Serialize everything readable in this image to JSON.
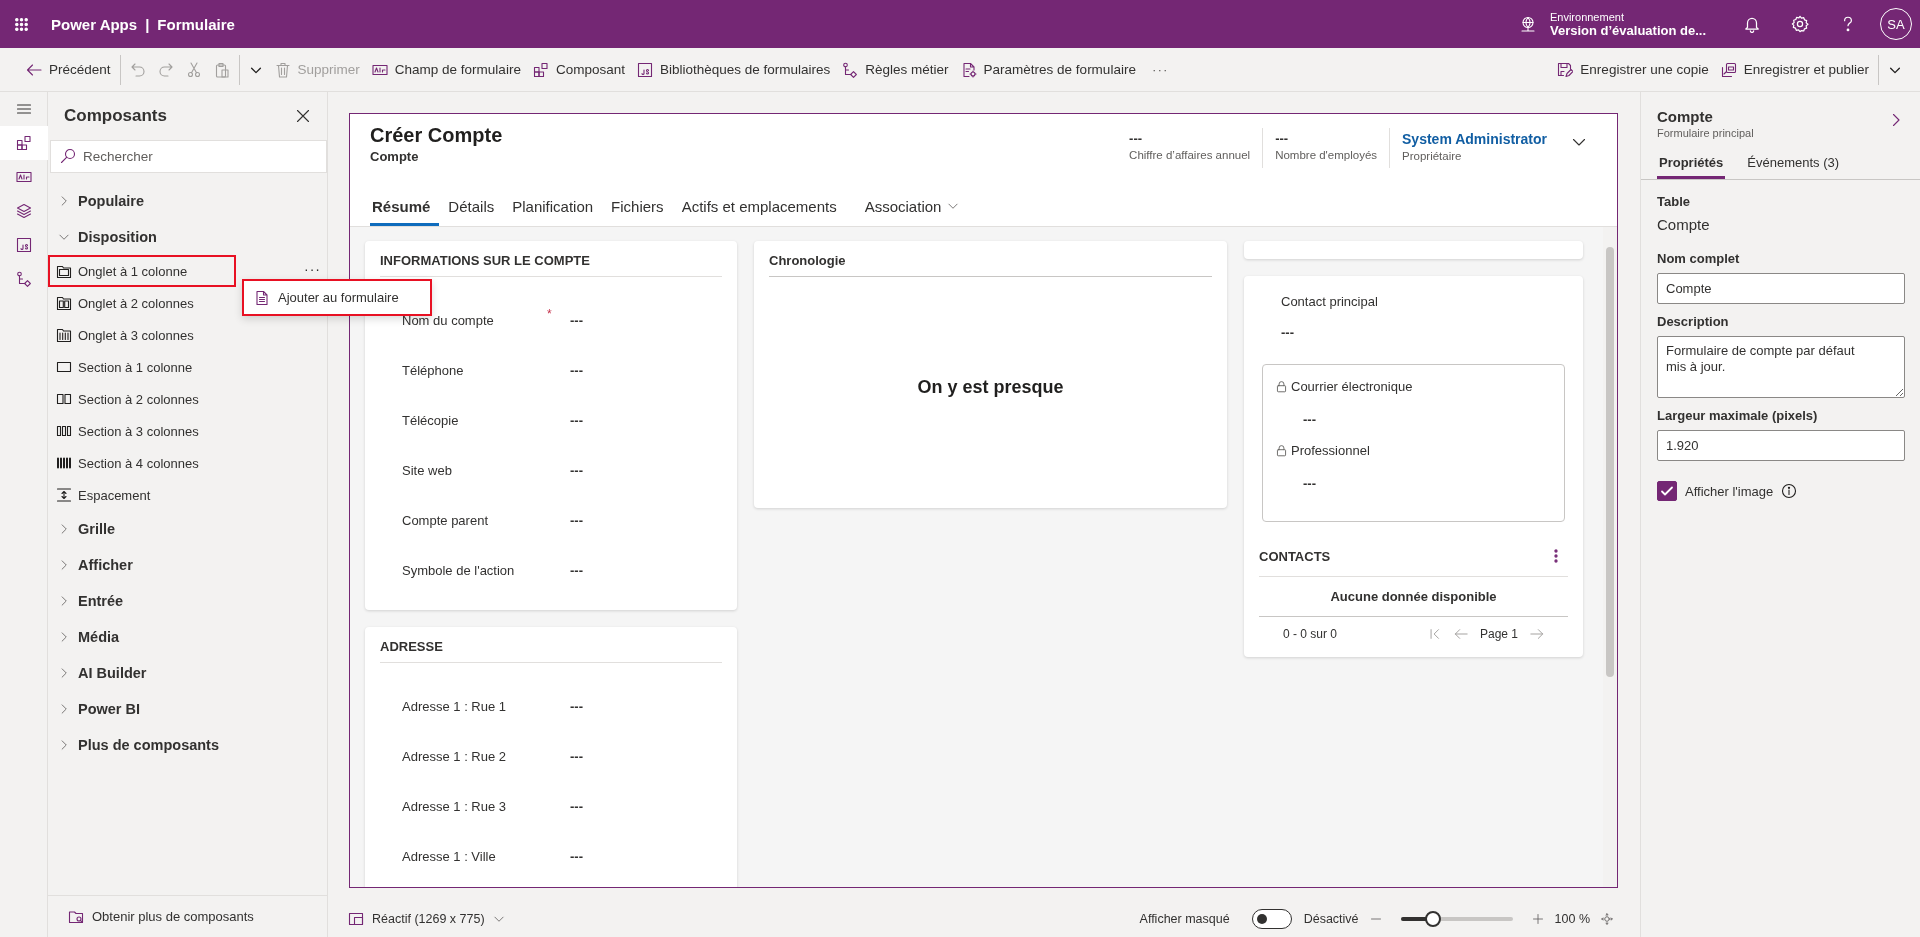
{
  "app_bar": {
    "product": "Power Apps",
    "separator": "|",
    "page": "Formulaire",
    "environment_label": "Environnement",
    "environment": "Version d’évaluation de...",
    "avatar": "SA"
  },
  "toolbar": {
    "left": [
      {
        "kind": "back",
        "label": "Précédent",
        "disabled": false
      },
      {
        "kind": "divider"
      },
      {
        "kind": "undo",
        "disabled": true
      },
      {
        "kind": "redo",
        "disabled": true
      },
      {
        "kind": "cut",
        "disabled": true
      },
      {
        "kind": "paste",
        "disabled": true
      },
      {
        "kind": "divider"
      },
      {
        "kind": "caret"
      },
      {
        "kind": "delete",
        "label": "Supprimer",
        "disabled": true
      },
      {
        "kind": "field",
        "label": "Champ de formulaire",
        "disabled": false
      },
      {
        "kind": "component",
        "label": "Composant",
        "disabled": false
      },
      {
        "kind": "library",
        "label": "Bibliothèques de formulaires",
        "disabled": false
      },
      {
        "kind": "rules",
        "label": "Règles métier",
        "disabled": false
      },
      {
        "kind": "settings",
        "label": "Paramètres de formulaire",
        "disabled": false
      },
      {
        "kind": "more",
        "label": "···",
        "disabled": false
      }
    ],
    "right": [
      {
        "kind": "save-copy",
        "label": "Enregistrer une copie",
        "disabled": false
      },
      {
        "kind": "publish",
        "label": "Enregistrer et publier",
        "disabled": false
      },
      {
        "kind": "divider"
      },
      {
        "kind": "caret"
      }
    ]
  },
  "rail": [
    {
      "kind": "menu",
      "selected": false
    },
    {
      "kind": "components",
      "selected": true
    },
    {
      "kind": "field",
      "selected": false
    },
    {
      "kind": "layers",
      "selected": false
    },
    {
      "kind": "library",
      "selected": false
    },
    {
      "kind": "rules",
      "selected": false
    }
  ],
  "components_panel": {
    "title": "Composants",
    "search": {
      "placeholder": "Rechercher"
    },
    "groups": [
      {
        "label": "Populaire",
        "expanded": false
      },
      {
        "label": "Disposition",
        "expanded": true,
        "children": [
          {
            "kind": "tab1",
            "label": "Onglet à 1 colonne",
            "highlighted": true,
            "more": "···"
          },
          {
            "kind": "tab2",
            "label": "Onglet à 2 colonnes",
            "highlighted": false
          },
          {
            "kind": "tab3",
            "label": "Onglet à 3 colonnes",
            "highlighted": false
          },
          {
            "kind": "sec1",
            "label": "Section à 1 colonne",
            "highlighted": false
          },
          {
            "kind": "sec2",
            "label": "Section à 2 colonnes",
            "highlighted": false
          },
          {
            "kind": "sec3",
            "label": "Section à 3 colonnes",
            "highlighted": false
          },
          {
            "kind": "sec4",
            "label": "Section à 4 colonnes",
            "highlighted": false
          },
          {
            "kind": "spacer",
            "label": "Espacement",
            "highlighted": false
          }
        ]
      },
      {
        "label": "Grille",
        "expanded": false
      },
      {
        "label": "Afficher",
        "expanded": false
      },
      {
        "label": "Entrée",
        "expanded": false
      },
      {
        "label": "Média",
        "expanded": false
      },
      {
        "label": "AI Builder",
        "expanded": false
      },
      {
        "label": "Power BI",
        "expanded": false
      },
      {
        "label": "Plus de composants",
        "expanded": false
      }
    ],
    "footer": "Obtenir plus de composants"
  },
  "context_menu": {
    "items": [
      {
        "label": "Ajouter au formulaire",
        "highlighted": true
      }
    ]
  },
  "form": {
    "title": "Créer Compte",
    "subtitle": "Compte",
    "required_symbol": "*",
    "header_fields": [
      {
        "kind": "text",
        "value": "---",
        "label": "Chiffre d’affaires annuel"
      },
      {
        "kind": "text",
        "value": "---",
        "label": "Nombre d'employés"
      },
      {
        "kind": "link",
        "value": "System Administrator",
        "label": "Propriétaire"
      }
    ],
    "tabs": [
      {
        "label": "Résumé",
        "selected": true,
        "has_menu": false
      },
      {
        "label": "Détails",
        "selected": false,
        "has_menu": false
      },
      {
        "label": "Planification",
        "selected": false,
        "has_menu": false
      },
      {
        "label": "Fichiers",
        "selected": false,
        "has_menu": false
      },
      {
        "label": "Actifs et emplacements",
        "selected": false,
        "has_menu": false
      },
      {
        "label": "Association",
        "selected": false,
        "has_menu": true
      }
    ],
    "column_1": [
      {
        "title": "INFORMATIONS SUR LE COMPTE",
        "fields": [
          {
            "label": "Nom du compte",
            "value": "---",
            "required": true
          },
          {
            "label": "Téléphone",
            "value": "---",
            "required": false
          },
          {
            "label": "Télécopie",
            "value": "---",
            "required": false
          },
          {
            "label": "Site web",
            "value": "---",
            "required": false
          },
          {
            "label": "Compte parent",
            "value": "---",
            "required": false
          },
          {
            "label": "Symbole de l'action",
            "value": "---",
            "required": false
          }
        ]
      },
      {
        "title": "ADRESSE",
        "fields": [
          {
            "label": "Adresse 1 : Rue 1",
            "value": "---",
            "required": false
          },
          {
            "label": "Adresse 1 : Rue 2",
            "value": "---",
            "required": false
          },
          {
            "label": "Adresse 1 : Rue 3",
            "value": "---",
            "required": false
          },
          {
            "label": "Adresse 1 : Ville",
            "value": "---",
            "required": false
          }
        ]
      }
    ],
    "column_2": {
      "title": "Chronologie",
      "message": "On y est presque"
    },
    "column_3": {
      "contact_label": "Contact principal",
      "contact_value": "---",
      "locked_fields": [
        {
          "label": "Courrier électronique",
          "value": "---"
        },
        {
          "label": "Professionnel",
          "value": "---"
        }
      ],
      "grid": {
        "title": "CONTACTS",
        "empty": "Aucune donnée disponible",
        "range": "0 - 0 sur 0",
        "page": "Page 1"
      }
    }
  },
  "properties": {
    "title": "Compte",
    "subtitle": "Formulaire principal",
    "tabs": [
      {
        "label": "Propriétés",
        "selected": true
      },
      {
        "label": "Événements (3)",
        "selected": false
      }
    ],
    "table_label": "Table",
    "table_value": "Compte",
    "fields": [
      {
        "kind": "input",
        "label": "Nom complet",
        "value": "Compte"
      },
      {
        "kind": "textarea",
        "label": "Description",
        "value": "Formulaire de compte par défaut mis à jour."
      },
      {
        "kind": "input",
        "label": "Largeur maximale (pixels)",
        "value": "1.920"
      }
    ],
    "checkbox": {
      "label": "Afficher l'image",
      "checked": true
    }
  },
  "status_bar": {
    "view": "Réactif (1269 x 775)",
    "hidden_label": "Afficher masqué",
    "toggle": {
      "on": false,
      "label": "Désactivé"
    },
    "zoom": {
      "level": 0.25,
      "reading": "100 %"
    }
  }
}
